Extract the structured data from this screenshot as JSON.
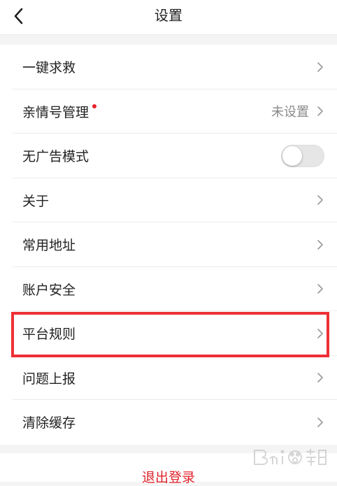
{
  "header": {
    "title": "设置",
    "back_icon": "chevron-left-icon"
  },
  "settings": {
    "items": [
      {
        "label": "一键求救",
        "icon": "chevron-right-icon"
      },
      {
        "label": "亲情号管理",
        "value": "未设置",
        "badge_color": "#e8202a",
        "icon": "chevron-right-icon"
      },
      {
        "label": "无广告模式",
        "control": "toggle",
        "toggle_on": false
      },
      {
        "label": "关于",
        "icon": "chevron-right-icon"
      },
      {
        "label": "常用地址",
        "icon": "chevron-right-icon"
      },
      {
        "label": "账户安全",
        "icon": "chevron-right-icon"
      },
      {
        "label": "平台规则",
        "icon": "chevron-right-icon",
        "highlighted": true
      },
      {
        "label": "问题上报",
        "icon": "chevron-right-icon"
      },
      {
        "label": "清除缓存",
        "icon": "chevron-right-icon"
      }
    ]
  },
  "logout": {
    "label": "退出登录",
    "color": "#e0232b"
  },
  "colors": {
    "highlight_border": "#ee3035",
    "background": "#f4f4f4",
    "value_text": "#8a8a8a"
  }
}
